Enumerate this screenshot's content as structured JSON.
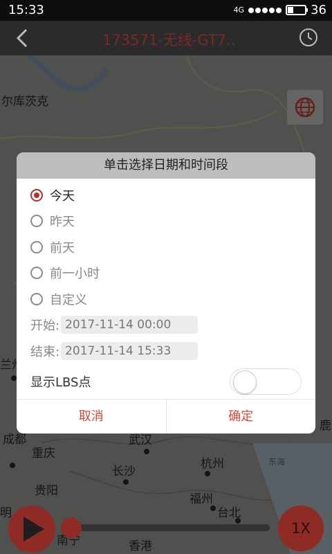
{
  "status": {
    "time": "15:33",
    "network": "4G",
    "battery": "36"
  },
  "header": {
    "title": "173571-无线-GT7.."
  },
  "map": {
    "labels": {
      "irkutsk": "尔库茨克",
      "lanzhou": "兰州",
      "chengdu": "成都",
      "chongqing": "重庆",
      "wuhan": "武汉",
      "hangzhou": "杭州",
      "donghai": "东海",
      "changsha": "长沙",
      "guiyang": "贵阳",
      "fuzhou": "福州",
      "taibei": "台北",
      "nanning": "南宁",
      "xianggang": "香港",
      "ming": "明",
      "lu": "鹿"
    }
  },
  "dialog": {
    "title": "单击选择日期和时间段",
    "options": [
      {
        "label": "今天",
        "selected": true
      },
      {
        "label": "昨天",
        "selected": false
      },
      {
        "label": "前天",
        "selected": false
      },
      {
        "label": "前一小时",
        "selected": false
      },
      {
        "label": "自定义",
        "selected": false
      }
    ],
    "start_label": "开始:",
    "start_value": "2017-11-14 00:00",
    "end_label": "结束:",
    "end_value": "2017-11-14 15:33",
    "lbs_label": "显示LBS点",
    "lbs_on": false,
    "cancel": "取消",
    "confirm": "确定"
  },
  "playback": {
    "speed": "1X",
    "progress": 0.0
  },
  "colors": {
    "accent": "#b92f2a",
    "button_text": "#d0483c",
    "header": "#2b2b2b"
  }
}
